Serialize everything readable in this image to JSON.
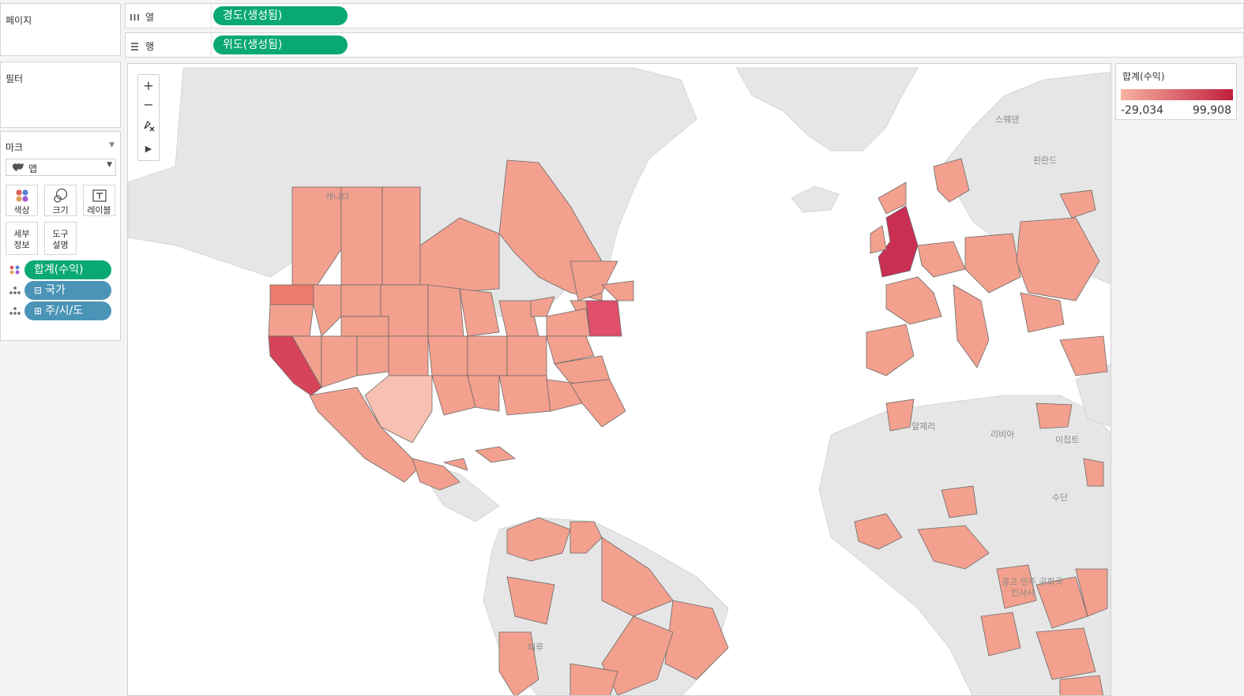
{
  "pages_label": "페이지",
  "filters_label": "필터",
  "columns": {
    "label": "열",
    "icon": "columns-icon",
    "pill": "경도(생성됨)"
  },
  "rows": {
    "label": "행",
    "icon": "rows-icon",
    "pill": "위도(생성됨)"
  },
  "marks": {
    "title": "마크",
    "type_label": "맵",
    "buttons": [
      {
        "label": "색상",
        "icon": "color-icon"
      },
      {
        "label": "크기",
        "icon": "size-icon"
      },
      {
        "label": "레이블",
        "icon": "label-icon"
      },
      {
        "label": "세부\n정보",
        "icon": "detail-icon"
      },
      {
        "label": "도구\n설명",
        "icon": "tooltip-icon"
      }
    ],
    "fields": [
      {
        "label": "합계(수익)",
        "prefix": "",
        "kind": "color"
      },
      {
        "label": "국가",
        "prefix": "⊟",
        "kind": "detail"
      },
      {
        "label": "주/시/도",
        "prefix": "⊞",
        "kind": "detail"
      }
    ]
  },
  "map": {
    "zoom_in": "+",
    "zoom_out": "−",
    "labels": [
      "캐나다",
      "스웨덴",
      "핀란드",
      "알제리",
      "리비아",
      "이집트",
      "수단",
      "콩고 민주 공화국",
      "킨샤사",
      "페루"
    ]
  },
  "legend": {
    "title": "합계(수익)",
    "min_label": "-29,034",
    "max_label": "99,908",
    "min_value": -29034,
    "max_value": 99908,
    "color_low": "#f7b2a2",
    "color_high": "#c11f3d"
  },
  "colors": {
    "pill_green": "#0aa974",
    "pill_blue": "#4a94b7",
    "land_gray": "#e8e8e8",
    "region_salmon": "#f3a08e"
  }
}
